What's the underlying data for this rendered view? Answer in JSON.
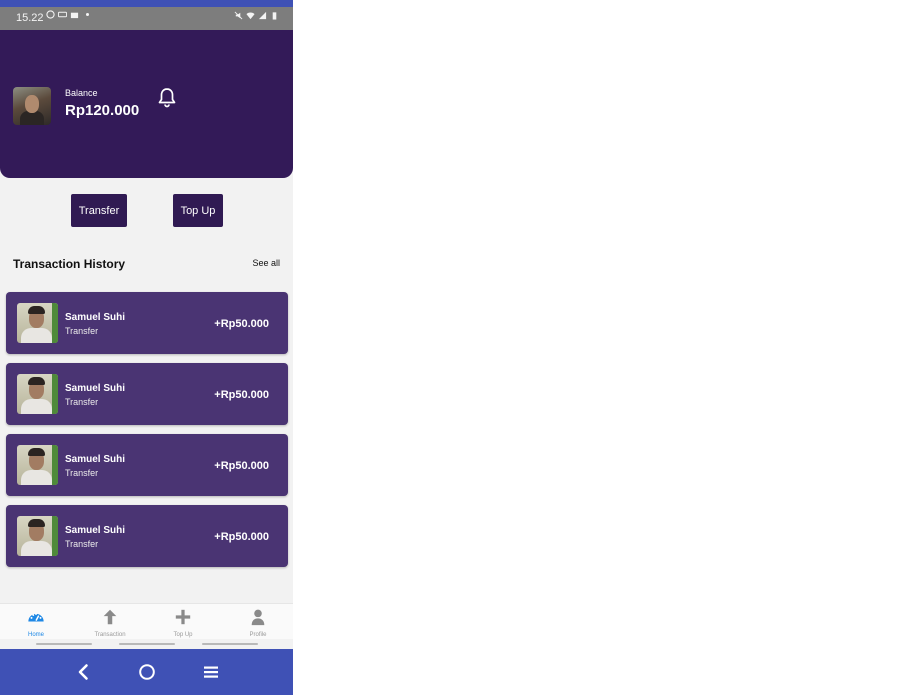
{
  "status_bar": {
    "time": "15.22",
    "left_icons": [
      "whatsapp-icon",
      "voicemail-icon",
      "bag-icon",
      "dot-icon"
    ],
    "right_icons": [
      "mute-icon",
      "wifi-icon",
      "signal-icon",
      "battery-icon"
    ]
  },
  "header": {
    "balance_label": "Balance",
    "balance_value": "Rp120.000",
    "avatar_icon": "user-photo",
    "notification_icon": "bell-icon"
  },
  "actions": {
    "transfer_label": "Transfer",
    "topup_label": "Top Up"
  },
  "history": {
    "title": "Transaction History",
    "see_all": "See all",
    "items": [
      {
        "name": "Samuel Suhi",
        "type": "Transfer",
        "amount": "+Rp50.000"
      },
      {
        "name": "Samuel Suhi",
        "type": "Transfer",
        "amount": "+Rp50.000"
      },
      {
        "name": "Samuel Suhi",
        "type": "Transfer",
        "amount": "+Rp50.000"
      },
      {
        "name": "Samuel Suhi",
        "type": "Transfer",
        "amount": "+Rp50.000"
      }
    ]
  },
  "bottom_nav": {
    "items": [
      {
        "label": "Home",
        "icon": "dashboard-icon",
        "active": true
      },
      {
        "label": "Transaction",
        "icon": "arrow-up-icon",
        "active": false
      },
      {
        "label": "Top Up",
        "icon": "plus-icon",
        "active": false
      },
      {
        "label": "Profile",
        "icon": "person-icon",
        "active": false
      }
    ]
  },
  "colors": {
    "header_bg": "#331a58",
    "card_bg": "#4a3473",
    "button_bg": "#301a53",
    "system_nav": "#3f51b5",
    "active_nav": "#1e88e5",
    "inactive_nav": "#8a8a8a"
  }
}
